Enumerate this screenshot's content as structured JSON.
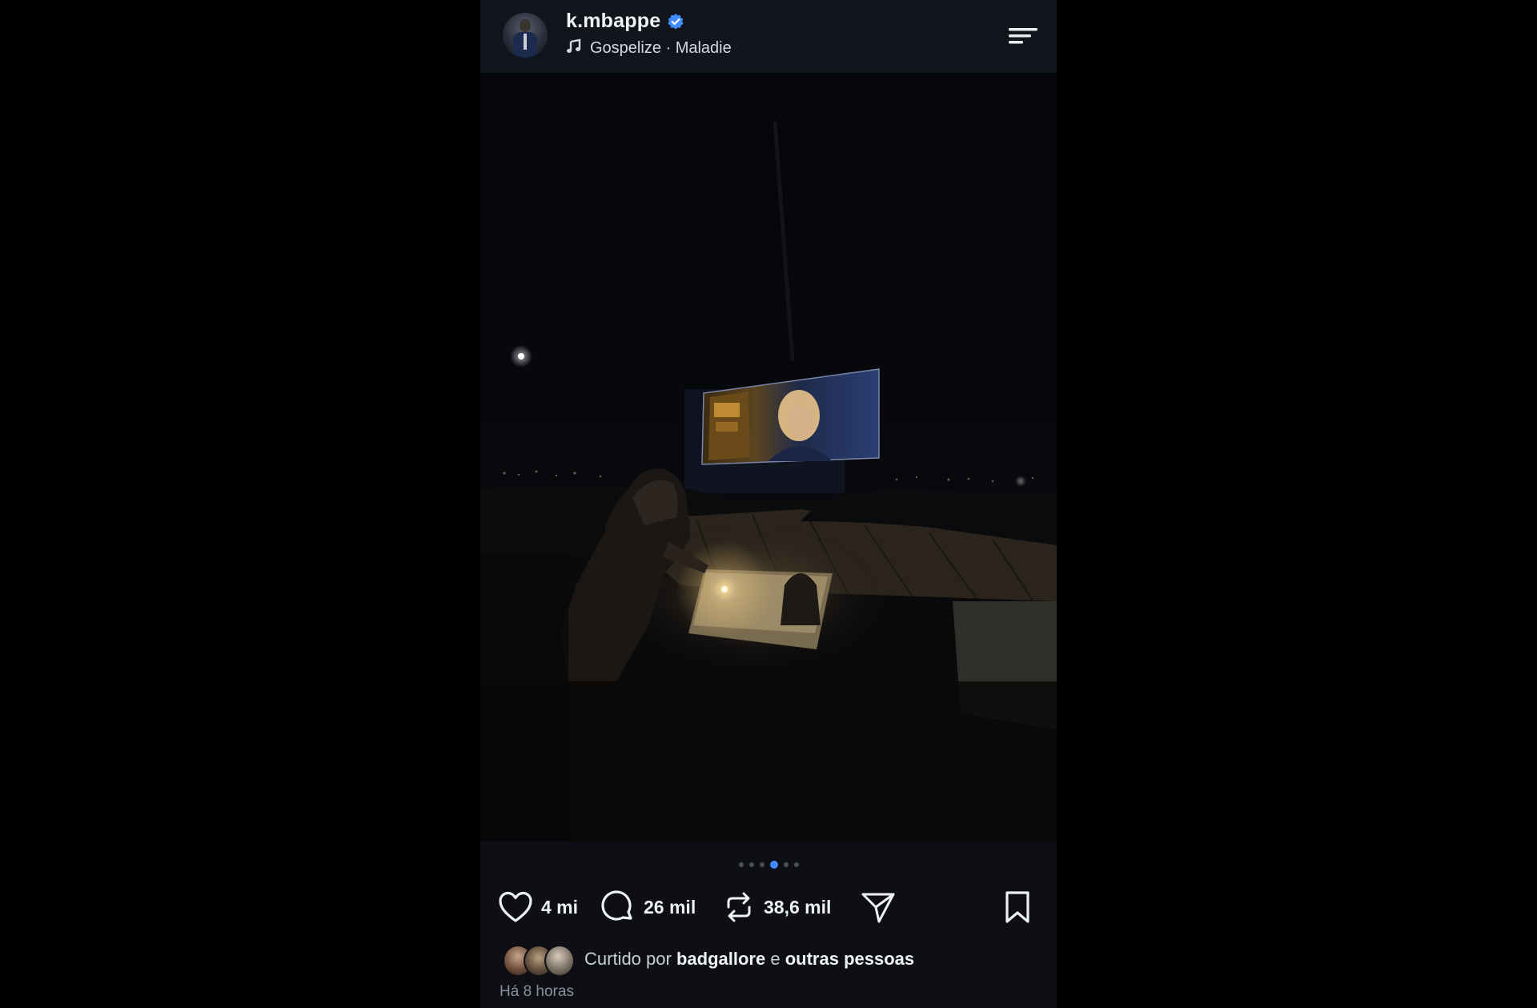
{
  "header": {
    "username": "k.mbappe",
    "verified": true,
    "music": "Gospelize · Maladie",
    "icons": {
      "avatar": "profile-avatar",
      "verified": "verified-badge-icon",
      "music": "music-note-icon",
      "menu": "menu-icon"
    }
  },
  "carousel": {
    "dot_count": 6,
    "active_index": 3,
    "active_color": "#3f8cff"
  },
  "actions": {
    "likes": "4 mi",
    "comments": "26 mil",
    "reposts": "38,6 mil",
    "icons": [
      "heart-icon",
      "comment-icon",
      "repost-icon",
      "share-icon",
      "bookmark-icon"
    ]
  },
  "liked_by": {
    "prefix": "Curtido por",
    "user": "badgallore",
    "joiner": "e",
    "others": "outras pessoas"
  },
  "time_ago": "Há 8 horas",
  "colors": {
    "background": "#000000",
    "panel": "#12151c",
    "accent": "#3f8cff"
  }
}
